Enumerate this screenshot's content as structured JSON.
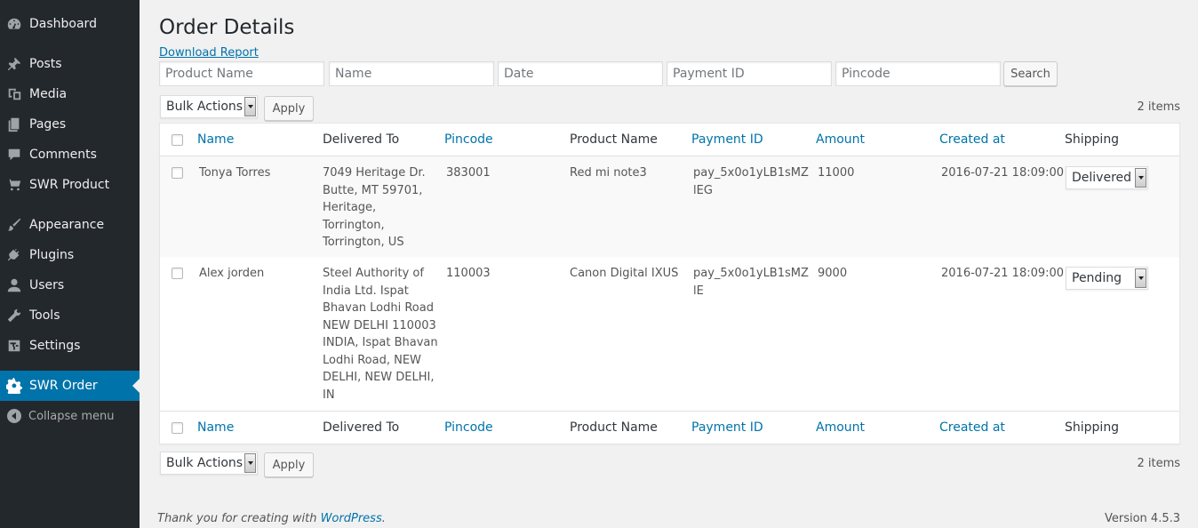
{
  "sidebar": {
    "items": [
      {
        "label": "Dashboard",
        "icon": "dashboard-icon"
      },
      {
        "label": "Posts",
        "icon": "pin-icon"
      },
      {
        "label": "Media",
        "icon": "media-icon"
      },
      {
        "label": "Pages",
        "icon": "pages-icon"
      },
      {
        "label": "Comments",
        "icon": "comment-icon"
      },
      {
        "label": "SWR Product",
        "icon": "cart-icon"
      },
      {
        "label": "Appearance",
        "icon": "brush-icon"
      },
      {
        "label": "Plugins",
        "icon": "plug-icon"
      },
      {
        "label": "Users",
        "icon": "user-icon"
      },
      {
        "label": "Tools",
        "icon": "wrench-icon"
      },
      {
        "label": "Settings",
        "icon": "settings-icon"
      },
      {
        "label": "SWR Order",
        "icon": "gear-icon",
        "current": true
      }
    ],
    "collapse_label": "Collapse menu"
  },
  "page": {
    "title": "Order Details",
    "download_link": "Download Report"
  },
  "filters": {
    "product_name_placeholder": "Product Name",
    "name_placeholder": "Name",
    "date_placeholder": "Date",
    "payment_id_placeholder": "Payment ID",
    "pincode_placeholder": "Pincode",
    "search_label": "Search"
  },
  "bulk": {
    "selected": "Bulk Actions",
    "apply_label": "Apply",
    "items_count": "2 items"
  },
  "table": {
    "columns": {
      "name": "Name",
      "delivered_to": "Delivered To",
      "pincode": "Pincode",
      "product_name": "Product Name",
      "payment_id": "Payment ID",
      "amount": "Amount",
      "created_at": "Created at",
      "shipping": "Shipping"
    },
    "rows": [
      {
        "name": "Tonya Torres",
        "delivered_to": "7049 Heritage Dr.\nButte, MT 59701,\nHeritage,\nTorrington,\nTorrington, US",
        "pincode": "383001",
        "product_name": "Red mi note3",
        "payment_id": "pay_5x0o1yLB1sMZ\nlEG",
        "amount": "11000",
        "created_at": "2016-07-21 18:09:00",
        "shipping": "Delivered"
      },
      {
        "name": "Alex jorden",
        "delivered_to": "Steel Authority of\nIndia Ltd. Ispat\nBhavan Lodhi Road\nNEW DELHI 110003\nINDIA, Ispat Bhavan\nLodhi Road, NEW\nDELHI, NEW DELHI,\nIN",
        "pincode": "110003",
        "product_name": "Canon Digital IXUS",
        "payment_id": "pay_5x0o1yLB1sMZ\nlE",
        "amount": "9000",
        "created_at": "2016-07-21 18:09:00",
        "shipping": "Pending"
      }
    ]
  },
  "footer": {
    "thanks_prefix": "Thank you for creating with ",
    "thanks_link": "WordPress",
    "thanks_suffix": ".",
    "version": "Version 4.5.3"
  },
  "colors": {
    "sidebar_bg": "#23282d",
    "accent": "#0073aa",
    "page_bg": "#f1f1f1"
  }
}
